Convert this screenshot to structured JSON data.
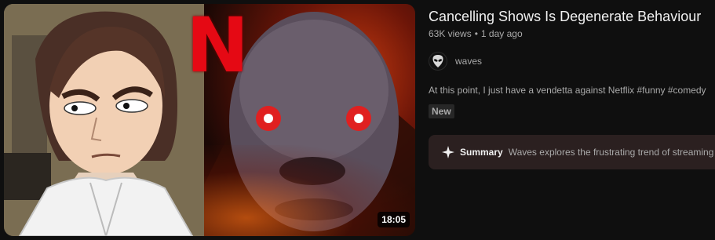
{
  "video": {
    "title": "Cancelling Shows Is Degenerate Behaviour",
    "views": "63K views",
    "separator": "•",
    "age": "1 day ago",
    "duration": "18:05",
    "description": "At this point, I just have a vendetta against Netflix #funny #comedy",
    "badge": "New",
    "thumbnail_logo": "N"
  },
  "channel": {
    "name": "waves",
    "avatar_icon": "alien-head-icon"
  },
  "summary": {
    "icon": "sparkle-icon",
    "label": "Summary",
    "text": "Waves explores the frustrating trend of streaming"
  },
  "colors": {
    "background": "#0f0f0f",
    "netflix_red": "#e50914",
    "summary_bg": "#2b2020"
  }
}
